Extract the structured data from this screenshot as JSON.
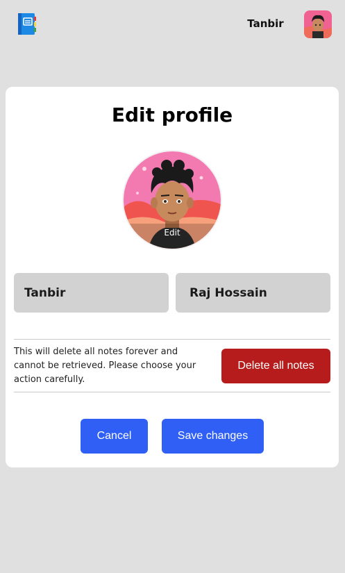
{
  "header": {
    "user_name": "Tanbir",
    "logo_icon": "notebook-icon",
    "avatar_icon": "user-avatar"
  },
  "profile": {
    "title": "Edit profile",
    "avatar_edit_label": "Edit",
    "first_name": "Tanbir",
    "last_name": "Raj Hossain"
  },
  "danger_zone": {
    "warning": "This will delete all notes forever and cannot be retrieved. Please choose your action carefully.",
    "delete_label": "Delete all notes",
    "color": "#b71c1c"
  },
  "actions": {
    "cancel_label": "Cancel",
    "save_label": "Save changes",
    "color": "#2f5ff5"
  }
}
